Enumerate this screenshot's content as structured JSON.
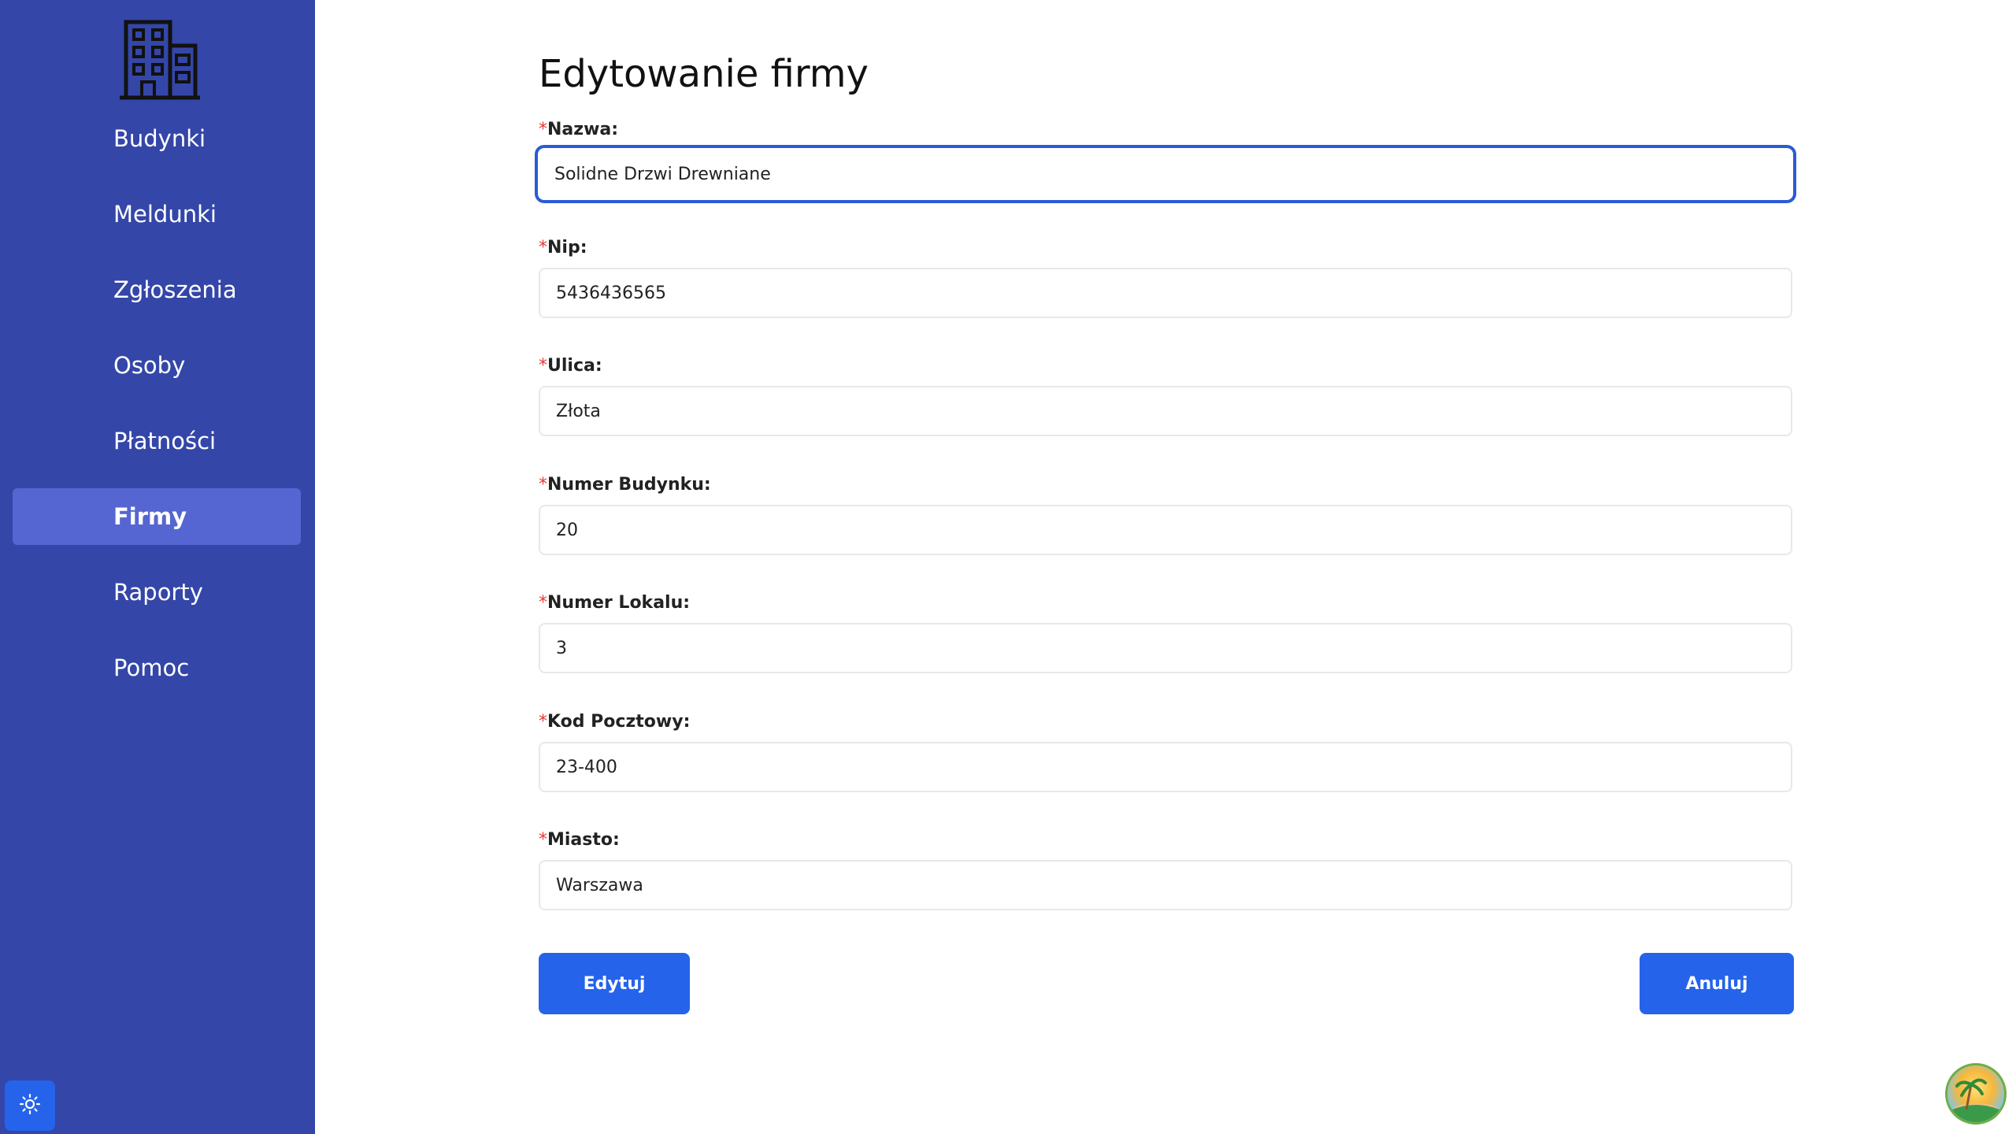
{
  "sidebar": {
    "logo_icon": "building-icon",
    "items": [
      {
        "label": "Budynki",
        "active": false
      },
      {
        "label": "Meldunki",
        "active": false
      },
      {
        "label": "Zgłoszenia",
        "active": false
      },
      {
        "label": "Osoby",
        "active": false
      },
      {
        "label": "Płatności",
        "active": false
      },
      {
        "label": "Firmy",
        "active": true
      },
      {
        "label": "Raporty",
        "active": false
      },
      {
        "label": "Pomoc",
        "active": false
      }
    ],
    "theme_toggle_icon": "sun-icon"
  },
  "form": {
    "title": "Edytowanie firmy",
    "required_marker": "*",
    "fields": [
      {
        "label": "Nazwa:",
        "value": "Solidne Drzwi Drewniane"
      },
      {
        "label": "Nip:",
        "value": "5436436565"
      },
      {
        "label": "Ulica:",
        "value": "Złota"
      },
      {
        "label": "Numer Budynku:",
        "value": "20"
      },
      {
        "label": "Numer Lokalu:",
        "value": "3"
      },
      {
        "label": "Kod Pocztowy:",
        "value": "23-400"
      },
      {
        "label": "Miasto:",
        "value": "Warszawa"
      }
    ],
    "submit_label": "Edytuj",
    "cancel_label": "Anuluj"
  },
  "colors": {
    "sidebar_bg": "#3446a8",
    "sidebar_active": "#5566d2",
    "primary": "#2563eb",
    "focus_border": "#2a5bd7",
    "required": "#e53935"
  },
  "avatar_icon": "beach-avatar-icon"
}
